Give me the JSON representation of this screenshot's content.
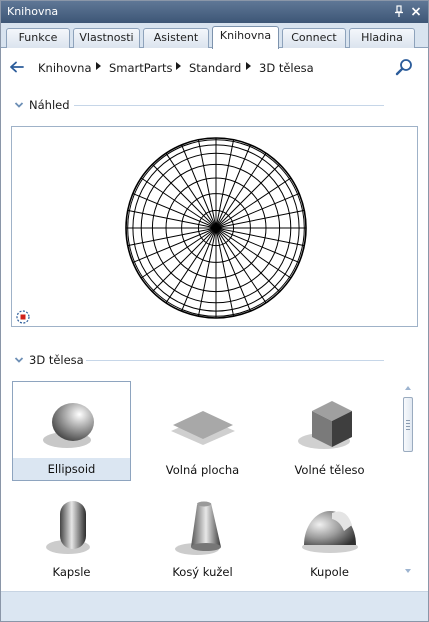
{
  "window": {
    "title": "Knihovna",
    "pin_icon": "pin-icon",
    "close_icon": "close-icon"
  },
  "tabs": [
    {
      "label": "Funkce",
      "active": false
    },
    {
      "label": "Vlastnosti",
      "active": false
    },
    {
      "label": "Asistent",
      "active": false
    },
    {
      "label": "Knihovna",
      "active": true
    },
    {
      "label": "Connect",
      "active": false
    },
    {
      "label": "Hladina",
      "active": false
    }
  ],
  "breadcrumb": {
    "back_icon": "back-arrow-icon",
    "items": [
      "Knihovna",
      "SmartParts",
      "Standard",
      "3D tělesa"
    ],
    "search_icon": "search-icon"
  },
  "preview_section": {
    "label": "Náhled",
    "collapse_icon": "chevron-down-icon"
  },
  "items_section": {
    "label": "3D tělesa",
    "collapse_icon": "chevron-down-icon",
    "items": [
      {
        "label": "Ellipsoid",
        "icon": "ellipsoid-icon",
        "selected": true
      },
      {
        "label": "Volná plocha",
        "icon": "free-surface-icon",
        "selected": false
      },
      {
        "label": "Volné těleso",
        "icon": "free-solid-icon",
        "selected": false
      },
      {
        "label": "Kapsle",
        "icon": "capsule-icon",
        "selected": false
      },
      {
        "label": "Kosý kužel",
        "icon": "oblique-cone-icon",
        "selected": false
      },
      {
        "label": "Kupole",
        "icon": "dome-icon",
        "selected": false
      }
    ]
  },
  "colors": {
    "titlebar": "#4a6384",
    "selection": "#dbe6f2",
    "accent_line": "#c6d6e8"
  }
}
